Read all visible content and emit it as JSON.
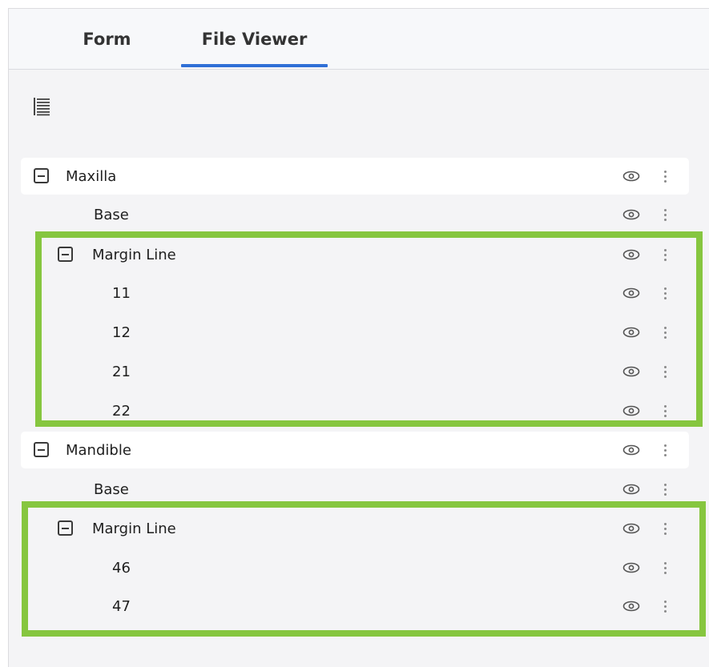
{
  "tabs": {
    "form": "Form",
    "file_viewer": "File Viewer",
    "active": "File Viewer"
  },
  "toolbar": {
    "list_icon": "list-lines-icon"
  },
  "tree": {
    "maxilla": {
      "label": "Maxilla",
      "base": "Base",
      "margin_line": {
        "label": "Margin Line",
        "items": [
          "11",
          "12",
          "21",
          "22"
        ]
      }
    },
    "mandible": {
      "label": "Mandible",
      "base": "Base",
      "margin_line": {
        "label": "Margin Line",
        "items": [
          "46",
          "47"
        ]
      }
    }
  },
  "icons": {
    "visibility": "eye-icon",
    "more": "more-vertical-icon",
    "collapse": "minus-square-icon"
  },
  "colors": {
    "accent": "#2f6fd6",
    "highlight": "#86c63f",
    "panel_bg": "#f4f4f6"
  }
}
